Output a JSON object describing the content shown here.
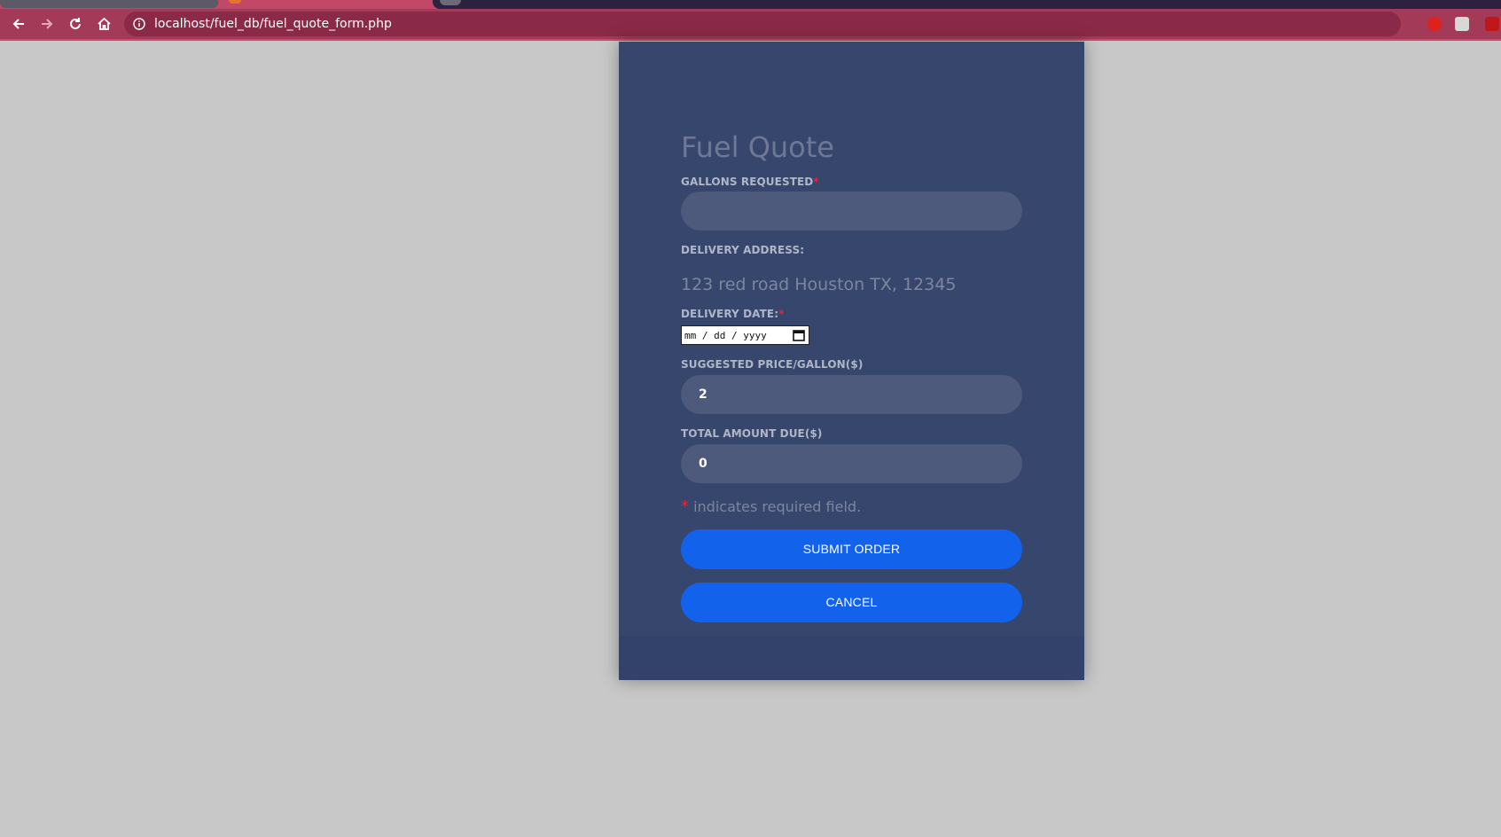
{
  "browser": {
    "url": "localhost/fuel_db/fuel_quote_form.php",
    "theme_color": "#a33a58"
  },
  "form": {
    "title": "Fuel Quote",
    "gallons": {
      "label": "GALLONS REQUESTED",
      "required_mark": "*",
      "value": ""
    },
    "address": {
      "label": "DELIVERY ADDRESS:",
      "value": "123 red road Houston TX, 12345"
    },
    "delivery_date": {
      "label": "DELIVERY DATE:",
      "required_mark": "*",
      "placeholder": "mm / dd / yyyy"
    },
    "price": {
      "label": "SUGGESTED PRICE/GALLON($)",
      "value": "2"
    },
    "total": {
      "label": "TOTAL AMOUNT DUE($)",
      "value": "0"
    },
    "required_note": {
      "mark": "*",
      "text": "indicates required field."
    },
    "submit_label": "SUBMIT ORDER",
    "cancel_label": "CANCEL",
    "accent_color": "#1362ec",
    "card_color": "#36466d"
  }
}
